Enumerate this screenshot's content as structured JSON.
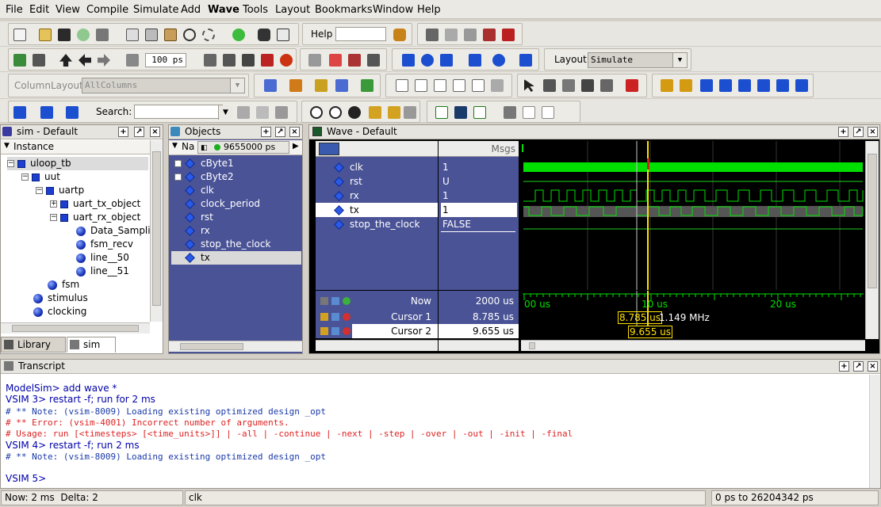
{
  "menubar": {
    "items": [
      "File",
      "Edit",
      "View",
      "Compile",
      "Simulate",
      "Add",
      "Wave",
      "Tools",
      "Layout",
      "Bookmarks",
      "Window",
      "Help"
    ]
  },
  "toolbar": {
    "help_label": "Help",
    "help_value": "",
    "zoom_time_value": "100 ps",
    "layout_label": "Layout",
    "layout_value": "Simulate",
    "column_layout_label": "ColumnLayout",
    "column_layout_value": "AllColumns",
    "search_label": "Search:",
    "search_value": ""
  },
  "sim_panel": {
    "title": "sim - Default",
    "column_header": "Instance",
    "items": [
      {
        "label": "uloop_tb",
        "icon": "module-icon"
      },
      {
        "label": "uut",
        "icon": "module-icon"
      },
      {
        "label": "uartp",
        "icon": "module-icon"
      },
      {
        "label": "uart_tx_object",
        "icon": "module-icon"
      },
      {
        "label": "uart_rx_object",
        "icon": "module-icon"
      },
      {
        "label": "Data_Sampli",
        "icon": "process-icon"
      },
      {
        "label": "fsm_recv",
        "icon": "process-icon"
      },
      {
        "label": "line__50",
        "icon": "process-icon"
      },
      {
        "label": "line__51",
        "icon": "process-icon"
      },
      {
        "label": "fsm",
        "icon": "process-icon"
      },
      {
        "label": "stimulus",
        "icon": "process-icon"
      },
      {
        "label": "clocking",
        "icon": "process-icon"
      }
    ],
    "tabs": [
      "Library",
      "sim"
    ]
  },
  "objects_panel": {
    "title": "Objects",
    "name_header": "Na",
    "time_value": "9655000 ps",
    "items": [
      "cByte1",
      "cByte2",
      "clk",
      "clock_period",
      "rst",
      "rx",
      "stop_the_clock",
      "tx"
    ]
  },
  "wave_panel": {
    "title": "Wave - Default",
    "msgs_header": "Msgs",
    "signals": [
      {
        "name": "clk",
        "value": "1"
      },
      {
        "name": "rst",
        "value": "U"
      },
      {
        "name": "rx",
        "value": "1"
      },
      {
        "name": "tx",
        "value": "1"
      },
      {
        "name": "stop_the_clock",
        "value": "FALSE"
      }
    ],
    "cursors": {
      "now_label": "Now",
      "now_value": "2000 us",
      "cursor1_label": "Cursor 1",
      "cursor1_value": "8.785 us",
      "cursor2_label": "Cursor 2",
      "cursor2_value": "9.655 us"
    },
    "timeline": {
      "tick_labels": [
        "00 us",
        "10 us",
        "20 us"
      ],
      "cursor1_tag": "8.785 us",
      "freq_tag": "1.149 MHz",
      "cursor2_tag": "9.655 us"
    },
    "colors": {
      "clk": "#00e000",
      "wave": "#00e000",
      "cursor_active": "#ffe000",
      "cursor_inactive": "#c8c8c8",
      "background": "#000000"
    }
  },
  "transcript": {
    "title": "Transcript",
    "lines": [
      {
        "text": "ModelSim> add wave *",
        "kind": "prompt"
      },
      {
        "text": "VSIM 3> restart -f; run for 2 ms",
        "kind": "prompt"
      },
      {
        "text": "# ** Note: (vsim-8009) Loading existing optimized design _opt",
        "kind": "note"
      },
      {
        "text": "# ** Error: (vsim-4001) Incorrect number of arguments.",
        "kind": "error"
      },
      {
        "text": "# Usage: run [<timesteps> [<time_units>]] | -all | -continue | -next | -step | -over | -out | -init | -final",
        "kind": "error"
      },
      {
        "text": "VSIM 4> restart -f; run 2 ms",
        "kind": "prompt"
      },
      {
        "text": "# ** Note: (vsim-8009) Loading existing optimized design _opt",
        "kind": "note"
      },
      {
        "text": "",
        "kind": "blank"
      },
      {
        "text": "VSIM 5>",
        "kind": "prompt"
      }
    ]
  },
  "statusbar": {
    "now": "Now: 2 ms",
    "delta": "Delta: 2",
    "selected": "clk",
    "range": "0 ps to 26204342 ps"
  }
}
